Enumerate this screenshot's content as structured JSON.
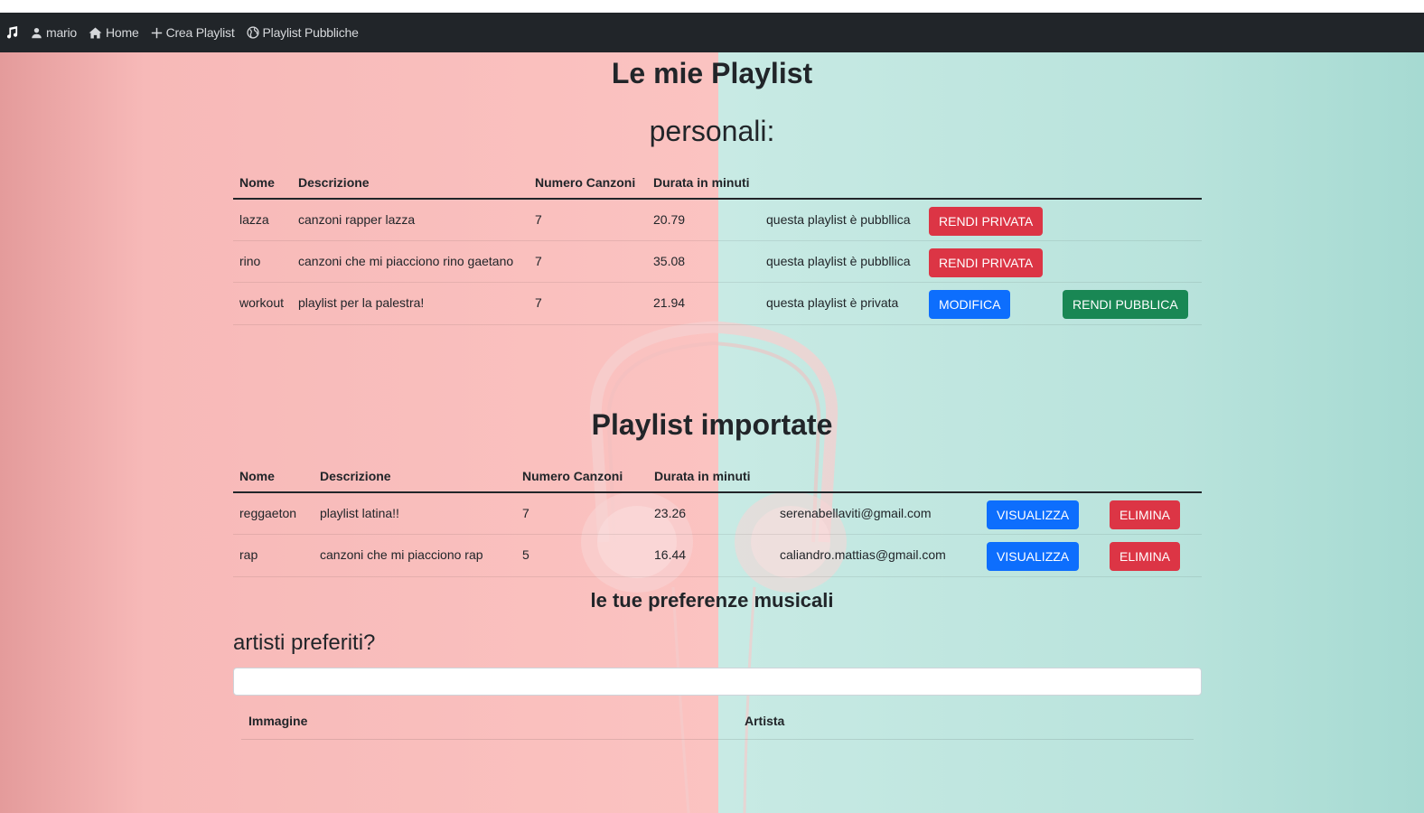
{
  "nav": {
    "brand_icon": "music-note-icon",
    "user": "mario",
    "home": "Home",
    "create": "Crea Playlist",
    "public": "Playlist Pubbliche"
  },
  "headings": {
    "title": "Le mie Playlist",
    "subtitle": "personali:",
    "imported": "Playlist importate",
    "preferences": "le tue preferenze musicali",
    "artists_question": "artisti preferiti?"
  },
  "personal": {
    "headers": [
      "Nome",
      "Descrizione",
      "Numero Canzoni",
      "Durata in minuti"
    ],
    "rows": [
      {
        "name": "lazza",
        "description": "canzoni rapper lazza",
        "count": "7",
        "duration": "20.79",
        "status": "questa playlist è pubbllica",
        "btn1": "RENDI PRIVATA"
      },
      {
        "name": "rino",
        "description": "canzoni che mi piacciono rino gaetano",
        "count": "7",
        "duration": "35.08",
        "status": "questa playlist è pubbllica",
        "btn1": "RENDI PRIVATA"
      },
      {
        "name": "workout",
        "description": "playlist per la palestra!",
        "count": "7",
        "duration": "21.94",
        "status": "questa playlist è privata",
        "btn1": "MODIFICA",
        "btn2": "RENDI PUBBLICA"
      }
    ]
  },
  "imported": {
    "headers": [
      "Nome",
      "Descrizione",
      "Numero Canzoni",
      "Durata in minuti"
    ],
    "rows": [
      {
        "name": "reggaeton",
        "description": "playlist latina!!",
        "count": "7",
        "duration": "23.26",
        "owner": "serenabellaviti@gmail.com",
        "view": "VISUALIZZA",
        "delete": "ELIMINA"
      },
      {
        "name": "rap",
        "description": "canzoni che mi piacciono rap",
        "count": "5",
        "duration": "16.44",
        "owner": "caliandro.mattias@gmail.com",
        "view": "VISUALIZZA",
        "delete": "ELIMINA"
      }
    ]
  },
  "artists": {
    "search_value": "",
    "headers": [
      "Immagine",
      "Artista"
    ]
  },
  "colors": {
    "navbar": "#212529",
    "danger": "#dc3545",
    "primary": "#0d6efd",
    "success": "#198754",
    "bg_left": "#fbc3c1",
    "bg_right": "#c8eae4"
  }
}
